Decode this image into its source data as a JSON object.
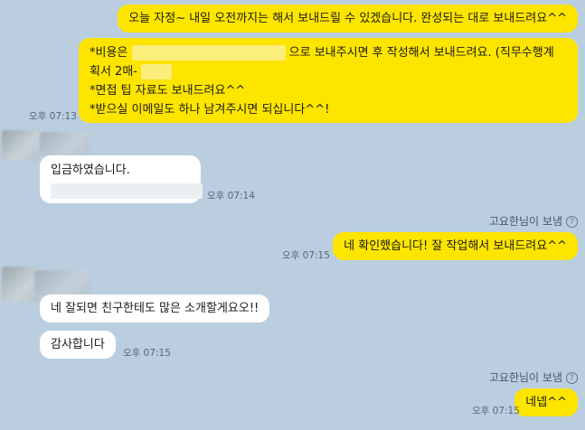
{
  "messages": {
    "m1": "오늘 자정~ 내일 오전까지는 해서 보내드릴 수 있겠습니다. 완성되는 대로 보내드려요^^",
    "m2_line1_a": "*비용은",
    "m2_line1_b": "으로 보내주시면 후 작성해서 보내드려요. (직무수행계",
    "m2_line2": "획서 2매-",
    "m2_line3": "*면접 팁 자료도 보내드려요^^",
    "m2_line4": "*받으실 이메일도 하나 남겨주시면 되십니다^^!",
    "m2_time": "오후 07:13",
    "r1": "입금하였습니다.",
    "r1_time": "오후 07:14",
    "sent_note_1": "고요한님이 보냄",
    "m3": "네 확인했습니다! 잘 작업해서 보내드려요^^",
    "m3_time": "오후 07:15",
    "r2": "네 잘되면 친구한테도 많은 소개할게요오!!",
    "r3": "감사합니다",
    "r3_time": "오후 07:15",
    "sent_note_2": "고요한님이 보냄",
    "m4": "네넵^^",
    "m4_time": "오후 07:15",
    "help_glyph": "?"
  },
  "colors": {
    "background": "#bacee0",
    "my_bubble": "#fee500",
    "their_bubble": "#ffffff"
  }
}
